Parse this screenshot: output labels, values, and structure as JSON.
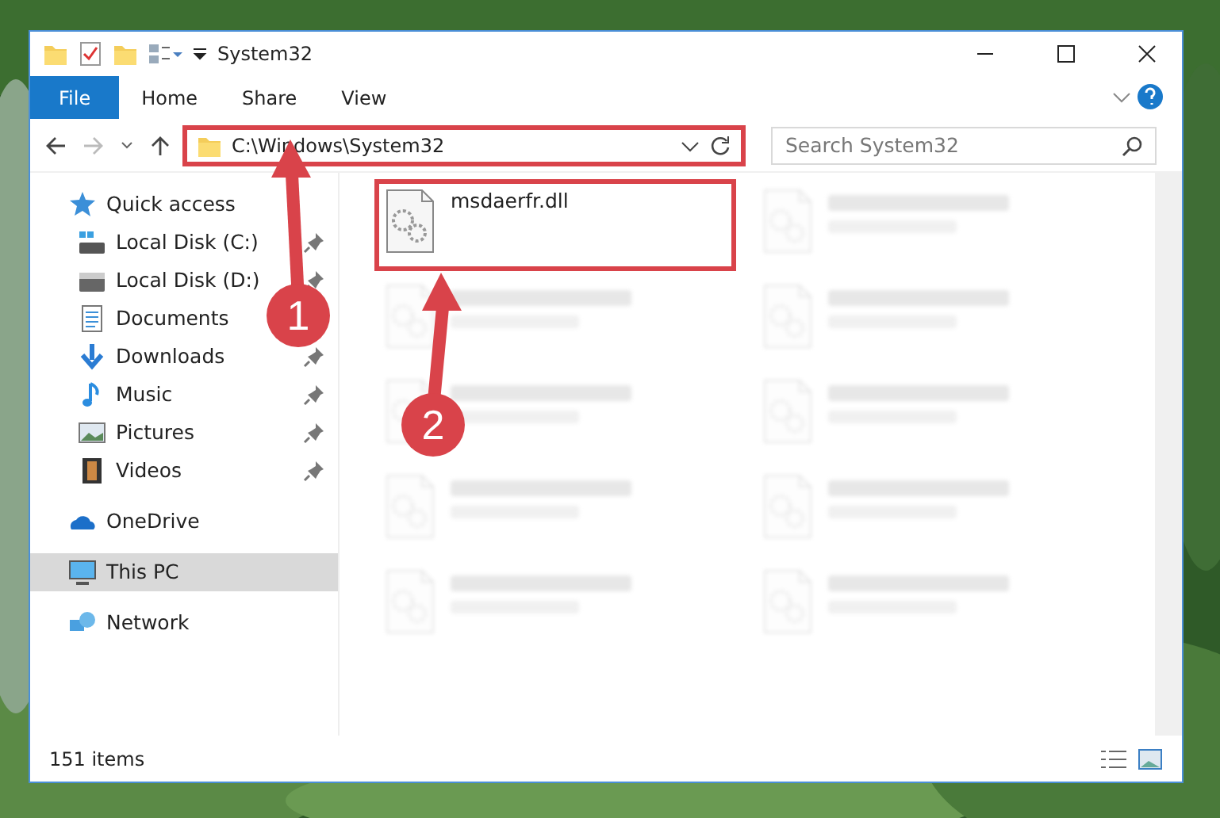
{
  "window": {
    "title": "System32",
    "status": "151 items"
  },
  "ribbon_tabs": [
    {
      "label": "File",
      "selected": true
    },
    {
      "label": "Home",
      "selected": false
    },
    {
      "label": "Share",
      "selected": false
    },
    {
      "label": "View",
      "selected": false
    }
  ],
  "address": {
    "path": "C:\\Windows\\System32",
    "highlighted": true
  },
  "search": {
    "placeholder": "Search System32"
  },
  "sidebar": [
    {
      "label": "Quick access",
      "kind": "star",
      "selected": false,
      "children": [
        {
          "label": "Local Disk (C:)",
          "kind": "drivec",
          "pinned": true,
          "selected": false
        },
        {
          "label": "Local Disk (D:)",
          "kind": "drive",
          "pinned": true,
          "selected": false
        },
        {
          "label": "Documents",
          "kind": "docs",
          "selected": false
        },
        {
          "label": "Downloads",
          "kind": "down",
          "pinned": true,
          "selected": false
        },
        {
          "label": "Music",
          "kind": "music",
          "pinned": true,
          "selected": false
        },
        {
          "label": "Pictures",
          "kind": "pics",
          "pinned": true,
          "selected": false
        },
        {
          "label": "Videos",
          "kind": "video",
          "pinned": true,
          "selected": false
        }
      ]
    },
    {
      "label": "OneDrive",
      "kind": "cloud",
      "selected": false
    },
    {
      "label": "This PC",
      "kind": "pc",
      "selected": true
    },
    {
      "label": "Network",
      "kind": "net",
      "selected": false
    }
  ],
  "files": [
    {
      "kind": "file",
      "name": "msdaerfr.dll",
      "highlighted": true
    },
    {
      "kind": "blurred"
    },
    {
      "kind": "blurred"
    },
    {
      "kind": "blurred"
    },
    {
      "kind": "blurred"
    },
    {
      "kind": "blurred"
    },
    {
      "kind": "blurred"
    },
    {
      "kind": "blurred"
    },
    {
      "kind": "blurred"
    },
    {
      "kind": "blurred"
    }
  ],
  "callouts": [
    {
      "label": "1"
    },
    {
      "label": "2"
    }
  ]
}
